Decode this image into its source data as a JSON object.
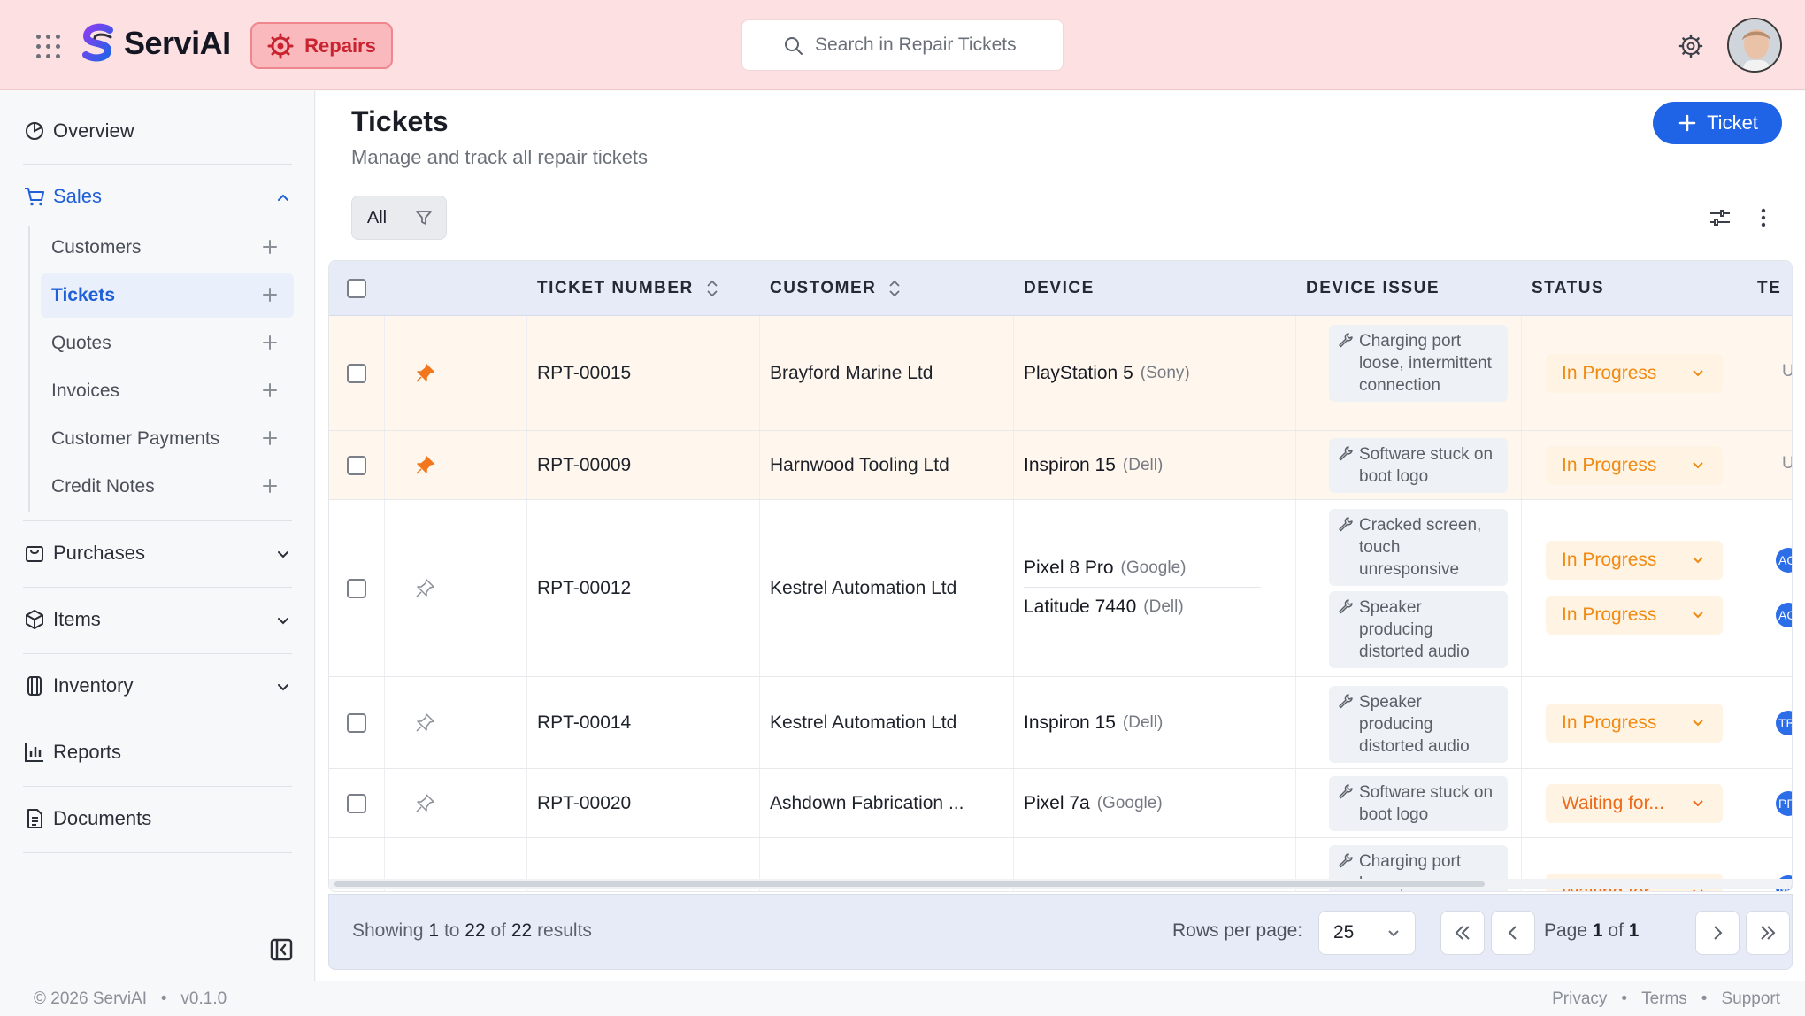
{
  "app": {
    "brand": "ServiAI",
    "module": "Repairs",
    "search_placeholder": "Search in Repair Tickets"
  },
  "colors": {
    "accent": "#1f63e6",
    "header_bg": "#fde0e2",
    "status_orange": "#f08a12",
    "pinned": "#f2761b"
  },
  "sidebar": {
    "overview": "Overview",
    "sales": {
      "label": "Sales",
      "items": [
        "Customers",
        "Tickets",
        "Quotes",
        "Invoices",
        "Customer Payments",
        "Credit Notes"
      ],
      "active": "Tickets"
    },
    "purchases": "Purchases",
    "items": "Items",
    "inventory": "Inventory",
    "reports": "Reports",
    "documents": "Documents"
  },
  "page": {
    "title": "Tickets",
    "subtitle": "Manage and track all repair tickets",
    "new_button": "Ticket",
    "filter_all": "All"
  },
  "table": {
    "headers": {
      "ticket_number": "TICKET NUMBER",
      "customer": "CUSTOMER",
      "device": "DEVICE",
      "device_issue": "DEVICE ISSUE",
      "status": "STATUS",
      "technician": "TE"
    },
    "rows": [
      {
        "pinned": true,
        "ticket": "RPT-00015",
        "customer": "Brayford Marine Ltd",
        "devices": [
          {
            "name": "PlayStation 5",
            "brand": "(Sony)"
          }
        ],
        "issues": [
          "Charging port loose, intermittent connection"
        ],
        "statuses": [
          "In Progress"
        ],
        "tech": [
          "Ur"
        ]
      },
      {
        "pinned": true,
        "ticket": "RPT-00009",
        "customer": "Harnwood Tooling Ltd",
        "devices": [
          {
            "name": "Inspiron 15",
            "brand": "(Dell)"
          }
        ],
        "issues": [
          "Software stuck on boot logo"
        ],
        "statuses": [
          "In Progress"
        ],
        "tech": [
          "Ur"
        ]
      },
      {
        "pinned": false,
        "ticket": "RPT-00012",
        "customer": "Kestrel Automation Ltd",
        "devices": [
          {
            "name": "Pixel 8 Pro",
            "brand": "(Google)"
          },
          {
            "name": "Latitude 7440",
            "brand": "(Dell)"
          }
        ],
        "issues": [
          "Cracked screen, touch unresponsive",
          "Speaker producing distorted audio"
        ],
        "statuses": [
          "In Progress",
          "In Progress"
        ],
        "tech": [
          "AG",
          "AG"
        ]
      },
      {
        "pinned": false,
        "ticket": "RPT-00014",
        "customer": "Kestrel Automation Ltd",
        "devices": [
          {
            "name": "Inspiron 15",
            "brand": "(Dell)"
          }
        ],
        "issues": [
          "Speaker producing distorted audio"
        ],
        "statuses": [
          "In Progress"
        ],
        "tech": [
          "TB"
        ]
      },
      {
        "pinned": false,
        "ticket": "RPT-00020",
        "customer": "Ashdown Fabrication ...",
        "devices": [
          {
            "name": "Pixel 7a",
            "brand": "(Google)"
          }
        ],
        "issues": [
          "Software stuck on boot logo"
        ],
        "statuses": [
          "Waiting for..."
        ],
        "tech": [
          "PR"
        ]
      },
      {
        "pinned": false,
        "ticket": "",
        "customer": "",
        "devices": [],
        "issues": [
          "Charging port loose,"
        ],
        "statuses": [
          "Waiting for..."
        ],
        "tech": [
          "M"
        ]
      }
    ]
  },
  "pagination": {
    "showing_prefix": "Showing",
    "from": "1",
    "to_word": "to",
    "to": "22",
    "of_word": "of",
    "total": "22",
    "results_word": "results",
    "rows_per_page_label": "Rows per page:",
    "rows_per_page": "25",
    "page_word": "Page",
    "page": "1",
    "page_of": "of",
    "page_total": "1"
  },
  "footer": {
    "copyright": "© 2026 ServiAI",
    "version": "v0.1.0",
    "links": [
      "Privacy",
      "Terms",
      "Support"
    ]
  }
}
